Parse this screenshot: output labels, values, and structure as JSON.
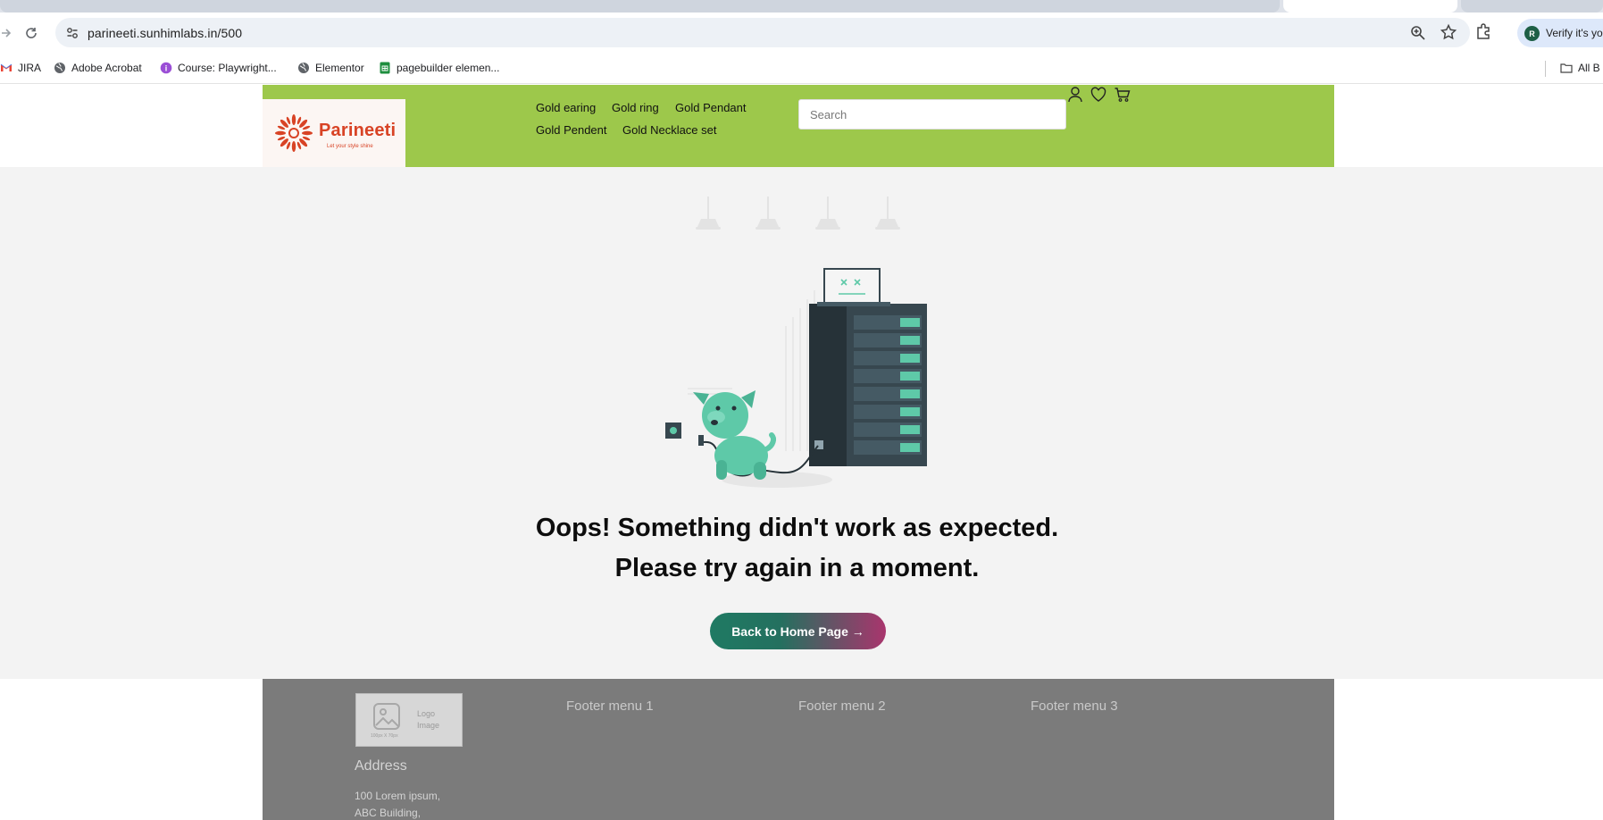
{
  "browser": {
    "url": "parineeti.sunhimlabs.in/500",
    "profile_initial": "R",
    "profile_button": "Verify it's yo",
    "bookmarks": [
      {
        "label": "JIRA",
        "icon": "gmail-icon"
      },
      {
        "label": "Adobe Acrobat",
        "icon": "globe-icon"
      },
      {
        "label": "Course: Playwright...",
        "icon": "course-icon"
      },
      {
        "label": "Elementor",
        "icon": "globe-icon"
      },
      {
        "label": "pagebuilder elemen...",
        "icon": "sheets-icon"
      }
    ],
    "all_bookmarks": "All B"
  },
  "site": {
    "logo_text": "Parineeti",
    "logo_tagline": "Let your style shine",
    "nav": [
      "Gold earing",
      "Gold ring",
      "Gold Pendant",
      "Gold Pendent",
      "Gold Necklace set"
    ],
    "search_placeholder": "Search"
  },
  "error": {
    "line1": "Oops! Something didn't work as expected.",
    "line2": "Please try again in a moment.",
    "button": "Back to Home Page →"
  },
  "footer": {
    "logo_label_1": "Logo",
    "logo_label_2": "Image",
    "logo_dim": "100px X 70px",
    "menus": [
      "Footer menu 1",
      "Footer menu 2",
      "Footer menu 3"
    ],
    "address_title": "Address",
    "address_lines": [
      "100 Lorem ipsum,",
      "ABC Building,"
    ]
  },
  "colors": {
    "header": "#9dc84b",
    "footer": "#7b7b7b",
    "main_bg": "#f3f3f3",
    "brand": "#d84325"
  }
}
